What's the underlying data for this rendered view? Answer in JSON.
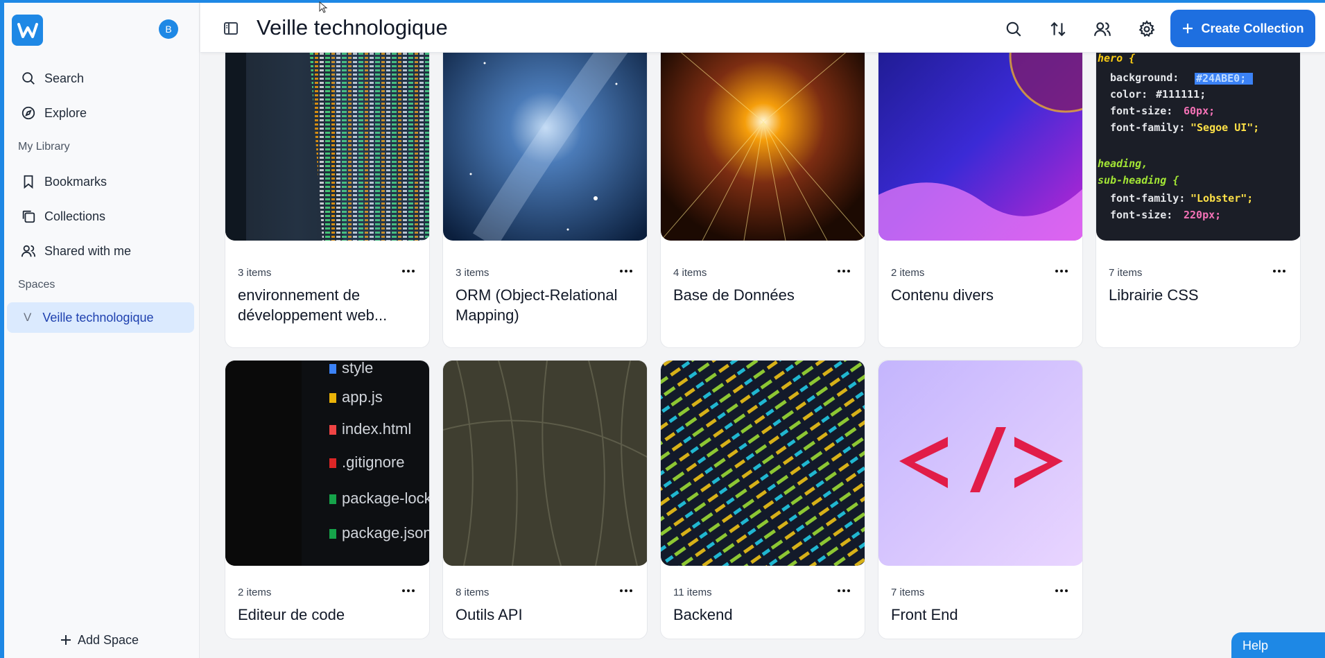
{
  "colors": {
    "accent": "#1e88e5",
    "button": "#1e6fe0",
    "active_space_bg": "#dbeafe"
  },
  "app": {
    "logo_icon": "w-logo-icon",
    "avatar_letter": "B"
  },
  "sidebar": {
    "items": [
      {
        "label": "Search",
        "icon": "search-icon"
      },
      {
        "label": "Explore",
        "icon": "compass-icon"
      }
    ],
    "library_label": "My Library",
    "library_items": [
      {
        "label": "Bookmarks",
        "icon": "bookmark-icon"
      },
      {
        "label": "Collections",
        "icon": "collections-icon"
      },
      {
        "label": "Shared with me",
        "icon": "users-icon"
      }
    ],
    "spaces_label": "Spaces",
    "spaces": [
      {
        "letter": "V",
        "label": "Veille technologique"
      }
    ],
    "add_space_label": "Add Space"
  },
  "header": {
    "title": "Veille technologique",
    "create_label": "Create Collection"
  },
  "collections": [
    {
      "count": "3 items",
      "name": "environnement de développement web...",
      "image": "code-monitor"
    },
    {
      "count": "3 items",
      "name": "ORM (Object-Relational Mapping)",
      "image": "milky-way"
    },
    {
      "count": "4 items",
      "name": "Base de Données",
      "image": "light-tunnel"
    },
    {
      "count": "2 items",
      "name": "Contenu divers",
      "image": "purple-abstract"
    },
    {
      "count": "7 items",
      "name": "Librairie CSS",
      "image": "css-code"
    },
    {
      "count": "2 items",
      "name": "Editeur de code",
      "image": "file-tree"
    },
    {
      "count": "8 items",
      "name": "Outils API",
      "image": "dark-lines"
    },
    {
      "count": "11 items",
      "name": "Backend",
      "image": "php-code"
    },
    {
      "count": "7 items",
      "name": "Front End",
      "image": "html-tag"
    }
  ],
  "css_snippet": {
    "selector1": "hero {",
    "bg_prop": "background:",
    "bg_val": "#24ABE0;",
    "color_prop": "color:",
    "color_val": "#111111;",
    "size_prop": "font-size:",
    "size_val": "60px;",
    "family_prop": "font-family:",
    "family_val": "\"Segoe UI\";",
    "selector2": "heading,",
    "selector3": "sub-heading {",
    "family2_val": "\"Lobster\";",
    "size2_val": "220px;"
  },
  "file_tree": [
    "style",
    "app.js",
    "index.html",
    ".gitignore",
    "package-lock.json",
    "package.json"
  ],
  "help_label": "Help"
}
